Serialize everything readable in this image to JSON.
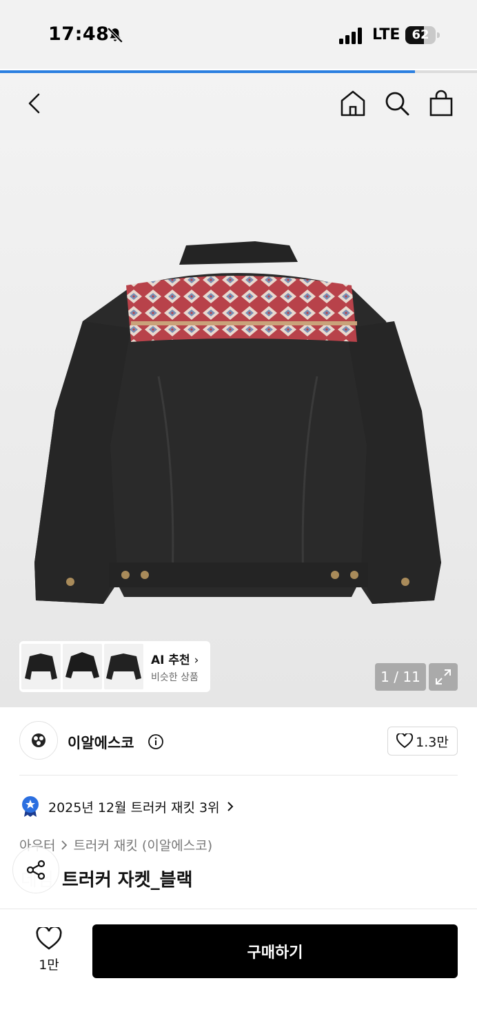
{
  "status_bar": {
    "time": "17:48",
    "network": "LTE",
    "battery": "62",
    "battery_level": 0.62,
    "icons": [
      "bell-muted-icon",
      "cellular-signal-icon",
      "battery-icon"
    ]
  },
  "image_progress": 0.87,
  "header": {
    "icons": [
      "back-icon",
      "home-icon",
      "search-icon",
      "shopping-bag-icon"
    ]
  },
  "gallery": {
    "ai_title": "AI 추천",
    "ai_subtitle": "비슷한 상품",
    "pager": "1 / 11"
  },
  "brand": {
    "name": "이알에스코",
    "likes": "1.3만"
  },
  "ranking": {
    "text": "2025년 12월 트러커 재킷 3위"
  },
  "breadcrumb": {
    "category": "아우터",
    "subcategory": "트러커 재킷 (이알에스코)"
  },
  "product": {
    "title_prefix": "데님",
    "title": "트러커 자켓_블랙"
  },
  "bottom_bar": {
    "wish_count": "1만",
    "buy_label": "구매하기"
  },
  "colors": {
    "accent_blue": "#2b7fe0",
    "buy_button": "#000000"
  }
}
